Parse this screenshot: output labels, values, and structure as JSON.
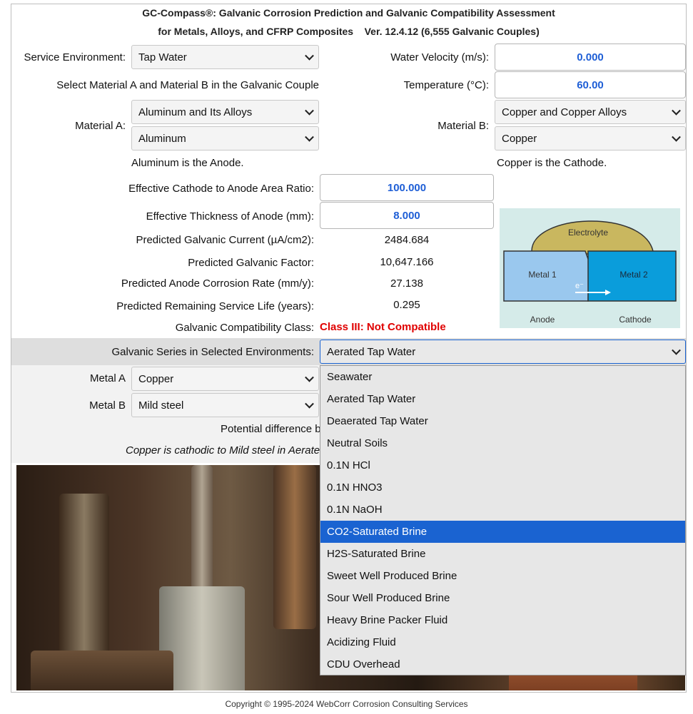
{
  "header": {
    "line1": "GC-Compass®: Galvanic Corrosion Prediction and Galvanic Compatibility Assessment",
    "line2": "for Metals, Alloys, and CFRP Composites    Ver. 12.4.12 (6,555 Galvanic Couples)"
  },
  "form": {
    "service_env_label": "Service Environment:",
    "service_env_value": "Tap Water",
    "water_velocity_label": "Water Velocity (m/s):",
    "water_velocity_value": "0.000",
    "select_materials_text": "Select Material A and Material B in the Galvanic Couple",
    "temperature_label": "Temperature (°C):",
    "temperature_value": "60.00",
    "material_a_label": "Material A:",
    "material_a_group": "Aluminum and Its Alloys",
    "material_a_value": "Aluminum",
    "material_b_label": "Material B:",
    "material_b_group": "Copper and Copper Alloys",
    "material_b_value": "Copper",
    "anode_note": "Aluminum is the Anode.",
    "cathode_note": "Copper is the Cathode.",
    "area_ratio_label": "Effective Cathode to Anode Area Ratio:",
    "area_ratio_value": "100.000",
    "thickness_label": "Effective Thickness of Anode (mm):",
    "thickness_value": "8.000"
  },
  "results": {
    "current_label": "Predicted Galvanic Current (µA/cm2):",
    "current_value": "2484.684",
    "factor_label": "Predicted Galvanic Factor:",
    "factor_value": "10,647.166",
    "rate_label": "Predicted Anode Corrosion Rate (mm/y):",
    "rate_value": "27.138",
    "life_label": "Predicted Remaining Service Life (years):",
    "life_value": "0.295",
    "class_label": "Galvanic Compatibility Class:",
    "class_value": "Class III: Not Compatible"
  },
  "diagram": {
    "electrolyte": "Electrolyte",
    "metal1": "Metal 1",
    "metal2": "Metal 2",
    "electron": "e⁻",
    "anode": "Anode",
    "cathode": "Cathode"
  },
  "series": {
    "label": "Galvanic Series in Selected Environments:",
    "value": "Aerated Tap Water",
    "metal_a_label": "Metal A",
    "metal_a_value": "Copper",
    "metal_b_label": "Metal B",
    "metal_b_value": "Mild steel",
    "potential_text": "Potential difference b",
    "cathodic_text": "Copper is cathodic to Mild steel in Aerate",
    "options": [
      "Seawater",
      "Aerated Tap Water",
      "Deaerated Tap Water",
      "Neutral Soils",
      "0.1N HCl",
      "0.1N HNO3",
      "0.1N NaOH",
      "CO2-Saturated Brine",
      "H2S-Saturated Brine",
      "Sweet Well Produced Brine",
      "Sour Well Produced Brine",
      "Heavy Brine Packer Fluid",
      "Acidizing Fluid",
      "CDU Overhead"
    ],
    "highlighted_option": "CO2-Saturated Brine"
  },
  "footer": {
    "copyright": "Copyright © 1995-2024 WebCorr Corrosion Consulting Services"
  },
  "colors": {
    "value_blue": "#1f5fd6",
    "alert_red": "#e00000",
    "highlight": "#1a63d1"
  }
}
